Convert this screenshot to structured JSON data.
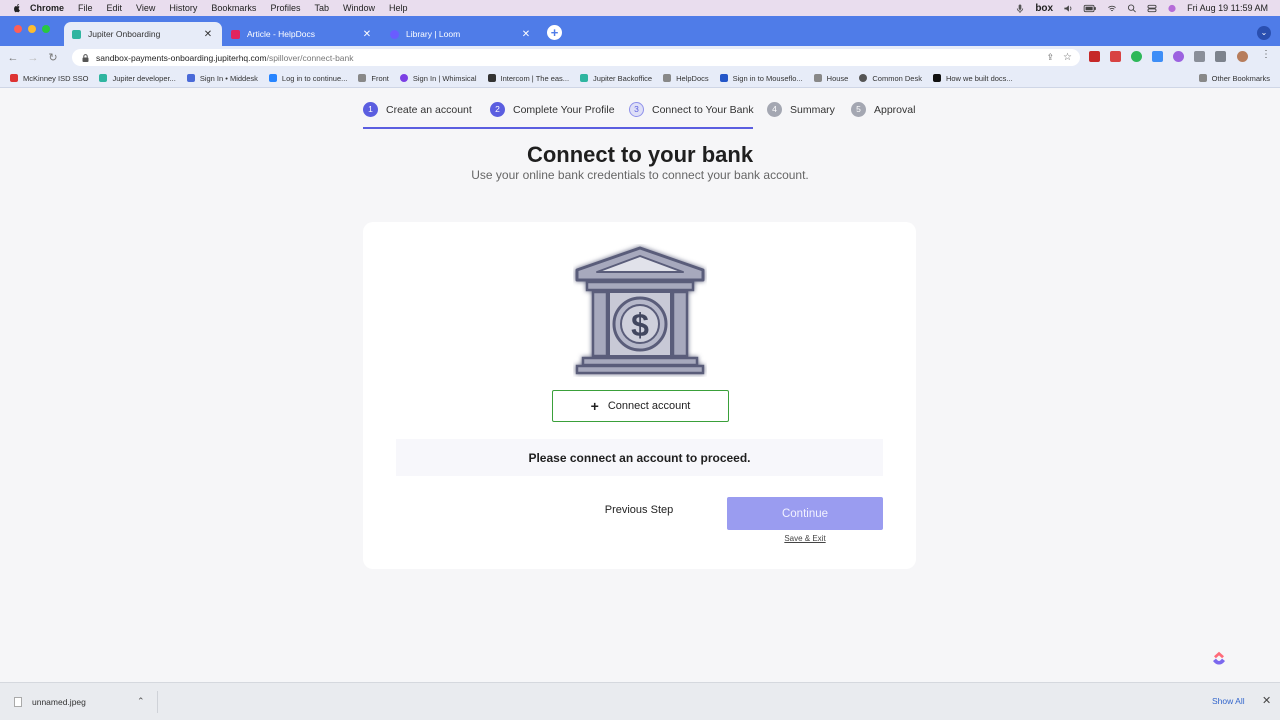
{
  "menubar": {
    "app": "Chrome",
    "items": [
      "File",
      "Edit",
      "View",
      "History",
      "Bookmarks",
      "Profiles",
      "Tab",
      "Window",
      "Help"
    ],
    "box_label": "box",
    "clock": "Fri Aug 19  11:59 AM"
  },
  "tabs": [
    {
      "title": "Jupiter Onboarding",
      "favicon_color": "#2fb5a0"
    },
    {
      "title": "Article - HelpDocs",
      "favicon_color": "#e0245e"
    },
    {
      "title": "Library | Loom",
      "favicon_color": "#6a5cff"
    }
  ],
  "address_bar": {
    "host": "sandbox-payments-onboarding.jupiterhq.com",
    "path": "/spillover/connect-bank"
  },
  "bookmarks": [
    {
      "label": "McKinney ISD SSO",
      "color": "#d33"
    },
    {
      "label": "Jupiter developer...",
      "color": "#2fb5a0"
    },
    {
      "label": "Sign In • Middesk",
      "color": "#4a6ad8"
    },
    {
      "label": "Log in to continue...",
      "color": "#2684ff"
    },
    {
      "label": "Front",
      "color": "#888"
    },
    {
      "label": "Sign In | Whimsical",
      "color": "#7b3fe4"
    },
    {
      "label": "Intercom | The eas...",
      "color": "#333"
    },
    {
      "label": "Jupiter Backoffice",
      "color": "#2fb5a0"
    },
    {
      "label": "HelpDocs",
      "color": "#e0245e"
    },
    {
      "label": "Sign in to Mouseflo...",
      "color": "#2456c8"
    },
    {
      "label": "House",
      "color": "#888"
    },
    {
      "label": "Common Desk",
      "color": "#555"
    },
    {
      "label": "How we built docs...",
      "color": "#111"
    }
  ],
  "bookmarks_other": "Other Bookmarks",
  "stepper": {
    "steps": [
      {
        "num": "1",
        "label": "Create an account"
      },
      {
        "num": "2",
        "label": "Complete Your Profile"
      },
      {
        "num": "3",
        "label": "Connect to Your Bank"
      },
      {
        "num": "4",
        "label": "Summary"
      },
      {
        "num": "5",
        "label": "Approval"
      }
    ],
    "current_step": 3
  },
  "page": {
    "title": "Connect to your bank",
    "subtitle": "Use your online bank credentials to connect your bank account.",
    "connect_label": "Connect account",
    "notice": "Please connect an account to proceed.",
    "previous_label": "Previous Step",
    "continue_label": "Continue",
    "save_exit_label": "Save & Exit"
  },
  "downloads": {
    "file": "unnamed.jpeg",
    "show_all": "Show All"
  },
  "colors": {
    "tabstrip": "#4f7ce8",
    "accent": "#5b5ee0",
    "continue_disabled": "#9a9cf0",
    "connect_border": "#3aa03a",
    "bank_icon": "#8e90a6"
  }
}
